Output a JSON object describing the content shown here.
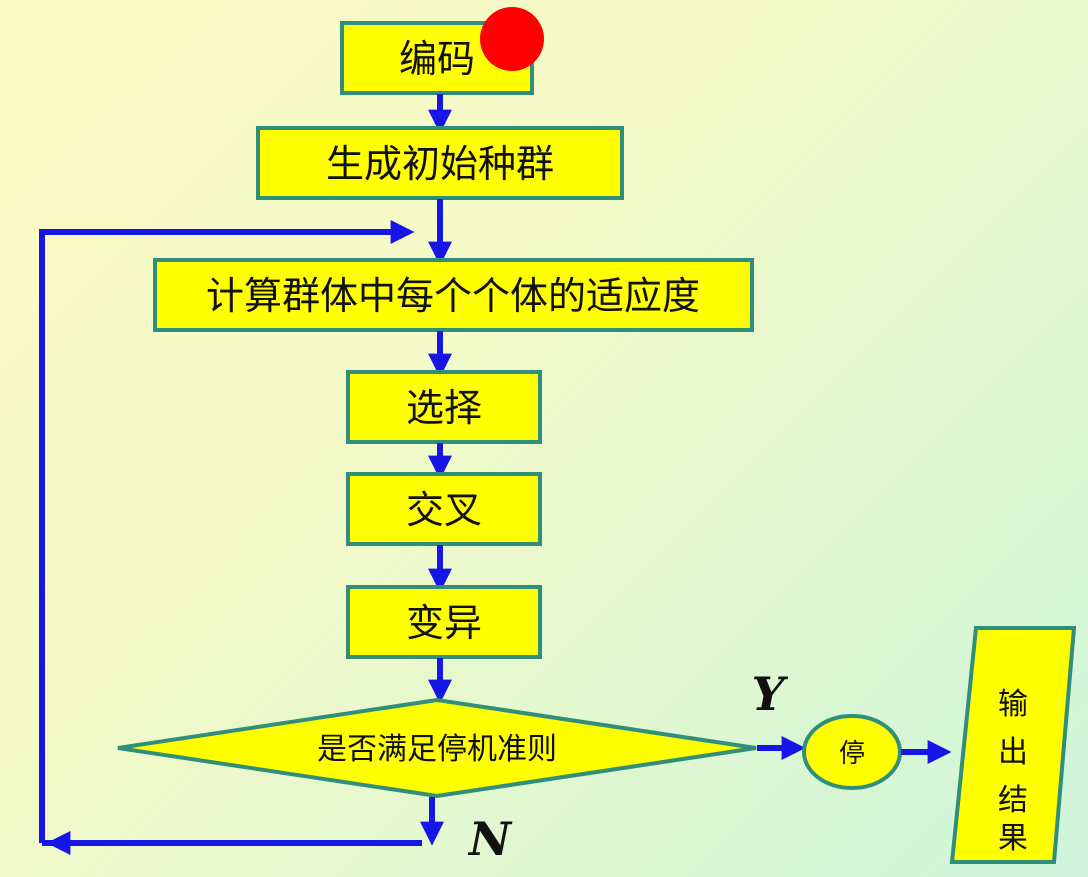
{
  "flow": {
    "encode": "编码",
    "init_population": "生成初始种群",
    "fitness": "计算群体中每个个体的适应度",
    "selection": "选择",
    "crossover": "交叉",
    "mutation": "变异",
    "stop_condition": "是否满足停机准则",
    "stop": "停",
    "output": [
      "输",
      "出",
      "结",
      "果"
    ],
    "yes_label": "Y",
    "no_label": "N"
  },
  "colors": {
    "box_fill": "#ffff00",
    "box_border": "#2f8f7a",
    "arrow": "#1616e6",
    "marker": "#ff0000"
  }
}
